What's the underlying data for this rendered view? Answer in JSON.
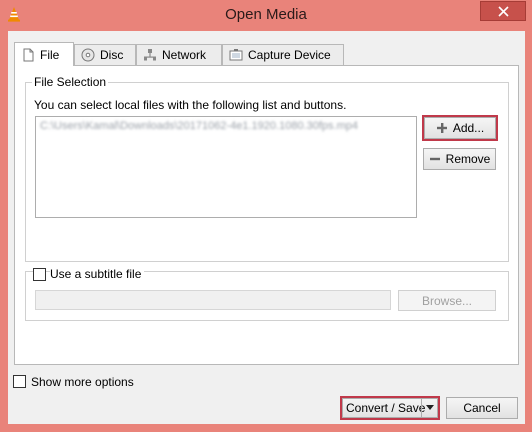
{
  "window": {
    "title": "Open Media"
  },
  "tabs": [
    {
      "label": "File",
      "icon": "file-icon",
      "active": true
    },
    {
      "label": "Disc",
      "icon": "disc-icon",
      "active": false
    },
    {
      "label": "Network",
      "icon": "network-icon",
      "active": false
    },
    {
      "label": "Capture Device",
      "icon": "capture-device-icon",
      "active": false
    }
  ],
  "file_selection": {
    "group_label": "File Selection",
    "description": "You can select local files with the following list and buttons.",
    "files": [
      "C:\\Users\\Kamal\\Downloads\\20171062-4e1.1920.1080.30fps.mp4"
    ],
    "add_label": "Add...",
    "remove_label": "Remove"
  },
  "subtitle": {
    "checkbox_label": "Use a subtitle file",
    "checked": false,
    "path_value": "",
    "browse_label": "Browse..."
  },
  "footer": {
    "show_more_label": "Show more options",
    "show_more_checked": false,
    "convert_label": "Convert / Save",
    "cancel_label": "Cancel"
  },
  "colors": {
    "frame": "#e9837a",
    "highlight": "#c0394a",
    "vlc_orange": "#f08a00"
  }
}
